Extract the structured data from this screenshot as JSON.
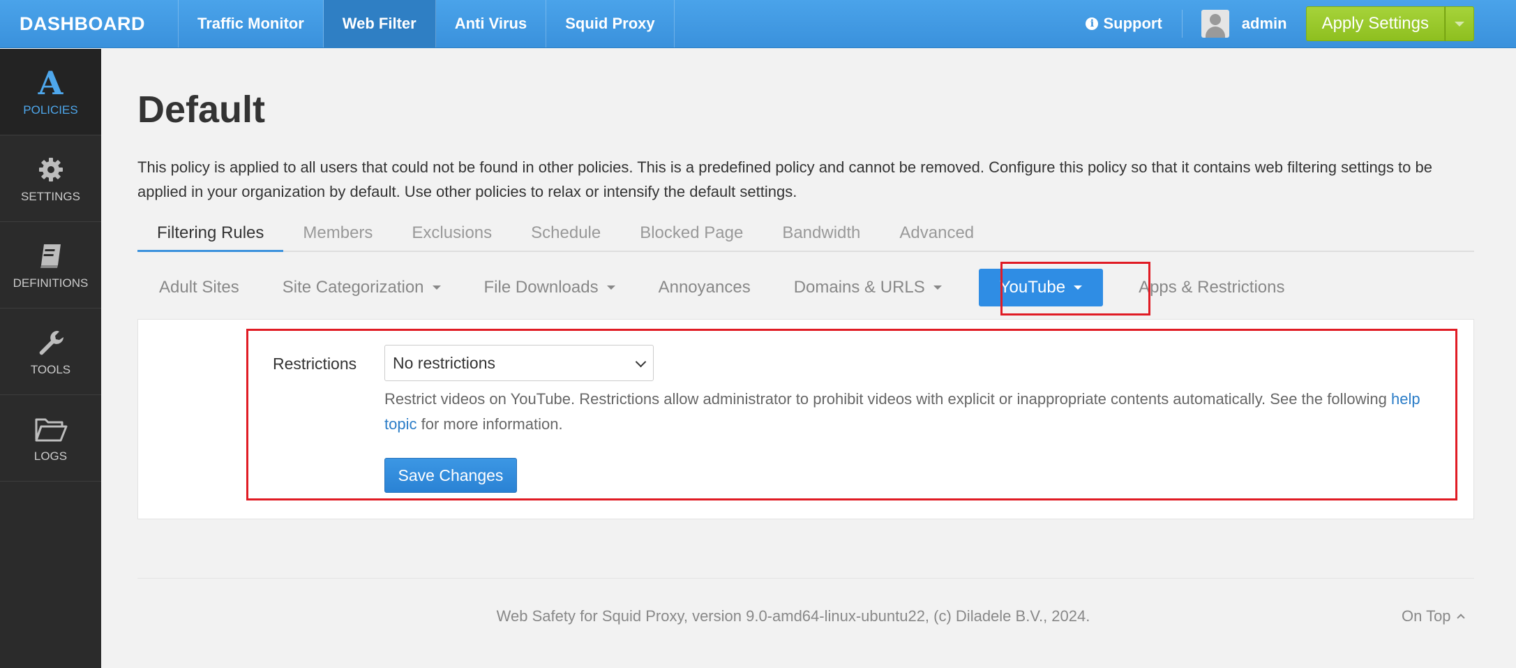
{
  "topbar": {
    "brand": "DASHBOARD",
    "tabs": [
      {
        "label": "Traffic Monitor"
      },
      {
        "label": "Web Filter"
      },
      {
        "label": "Anti Virus"
      },
      {
        "label": "Squid Proxy"
      }
    ],
    "support_label": "Support",
    "username": "admin",
    "apply_label": "Apply Settings"
  },
  "sidebar": {
    "items": [
      {
        "label": "POLICIES",
        "icon": "policies-logo-icon"
      },
      {
        "label": "SETTINGS",
        "icon": "gear-icon"
      },
      {
        "label": "DEFINITIONS",
        "icon": "book-icon"
      },
      {
        "label": "TOOLS",
        "icon": "wrench-icon"
      },
      {
        "label": "LOGS",
        "icon": "folder-icon"
      }
    ]
  },
  "page": {
    "title": "Default",
    "description": "This policy is applied to all users that could not be found in other policies. This is a predefined policy and cannot be removed. Configure this policy so that it contains web filtering settings to be applied in your organization by default. Use other policies to relax or intensify the default settings."
  },
  "tabs": [
    {
      "label": "Filtering Rules"
    },
    {
      "label": "Members"
    },
    {
      "label": "Exclusions"
    },
    {
      "label": "Schedule"
    },
    {
      "label": "Blocked Page"
    },
    {
      "label": "Bandwidth"
    },
    {
      "label": "Advanced"
    }
  ],
  "subtabs": [
    {
      "label": "Adult Sites"
    },
    {
      "label": "Site Categorization"
    },
    {
      "label": "File Downloads"
    },
    {
      "label": "Annoyances"
    },
    {
      "label": "Domains & URLS"
    },
    {
      "label": "YouTube"
    },
    {
      "label": "Apps & Restrictions"
    }
  ],
  "form": {
    "restrictions_label": "Restrictions",
    "restrictions_value": "No restrictions",
    "help_before": "Restrict videos on YouTube. Restrictions allow administrator to prohibit videos with explicit or inappropriate contents automatically. See the following ",
    "help_link": "help topic",
    "help_after": " for more information.",
    "save_label": "Save Changes"
  },
  "footer": {
    "text": "Web Safety for Squid Proxy, version 9.0-amd64-linux-ubuntu22, (c) Diladele B.V., 2024.",
    "on_top": "On Top"
  },
  "colors": {
    "navbar": "#3a91dc",
    "apply_button": "#8ebf1f",
    "highlight": "#e01b24",
    "primary_button": "#2f8de4"
  }
}
